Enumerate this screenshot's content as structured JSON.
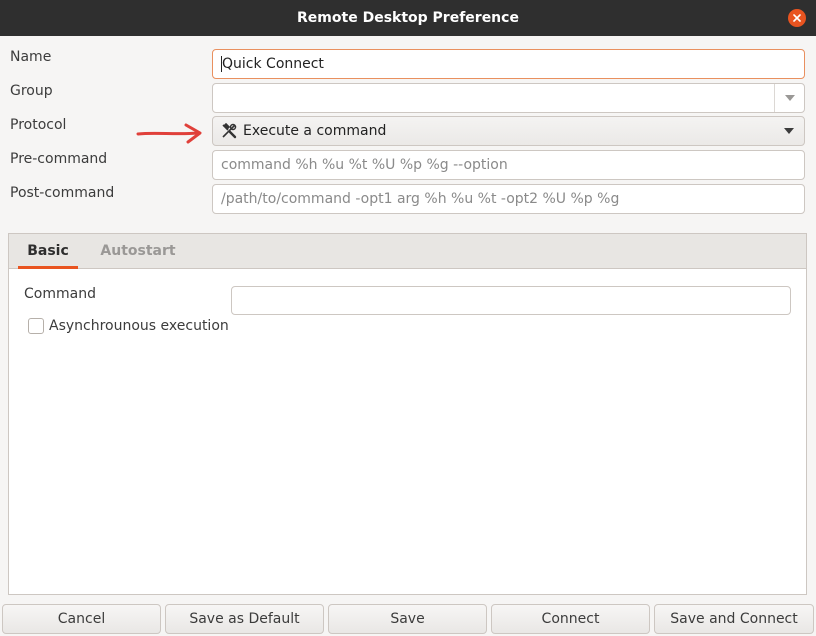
{
  "window": {
    "title": "Remote Desktop Preference"
  },
  "form": {
    "name_label": "Name",
    "name_value": "Quick Connect",
    "group_label": "Group",
    "group_value": "",
    "protocol_label": "Protocol",
    "protocol_value": "Execute a command",
    "precommand_label": "Pre-command",
    "precommand_placeholder": "command %h %u %t %U %p %g --option",
    "postcommand_label": "Post-command",
    "postcommand_placeholder": "/path/to/command -opt1 arg %h %u %t -opt2 %U %p %g"
  },
  "tabs": [
    {
      "label": "Basic",
      "active": true
    },
    {
      "label": "Autostart",
      "active": false
    }
  ],
  "basic": {
    "command_label": "Command",
    "command_value": "",
    "async_label": "Asynchrounous execution",
    "async_checked": false
  },
  "buttons": {
    "cancel": "Cancel",
    "save_default": "Save as Default",
    "save": "Save",
    "connect": "Connect",
    "save_connect": "Save and Connect"
  },
  "colors": {
    "accent": "#e95420",
    "annotation_arrow": "#e0403a",
    "titlebar": "#2f2f2f"
  },
  "icons": {
    "protocol_icon": "tools-icon",
    "close": "close-icon",
    "dropdown": "chevron-down-icon"
  }
}
